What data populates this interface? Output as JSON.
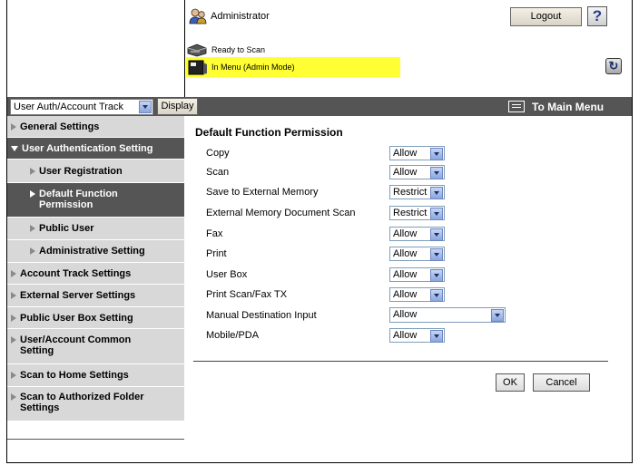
{
  "header": {
    "admin_label": "Administrator",
    "logout_label": "Logout",
    "help_label": "?",
    "status_ready": "Ready to Scan",
    "status_menu": "In Menu (Admin Mode)"
  },
  "toolbar": {
    "mode_select_value": "User Auth/Account Track",
    "display_label": "Display",
    "main_menu_label": "To Main Menu"
  },
  "sidebar": {
    "items": [
      {
        "label": "General Settings"
      },
      {
        "label": "User Authentication Setting"
      },
      {
        "label": "User Registration"
      },
      {
        "label": "Default Function Permission"
      },
      {
        "label": "Public User"
      },
      {
        "label": "Administrative Setting"
      },
      {
        "label": "Account Track Settings"
      },
      {
        "label": "External Server Settings"
      },
      {
        "label": "Public User Box Setting"
      },
      {
        "label": "User/Account Common Setting"
      },
      {
        "label": "Scan to Home Settings"
      },
      {
        "label": "Scan to Authorized Folder Settings"
      }
    ]
  },
  "content": {
    "title": "Default Function Permission",
    "rows": [
      {
        "label": "Copy",
        "value": "Allow"
      },
      {
        "label": "Scan",
        "value": "Allow"
      },
      {
        "label": "Save to External Memory",
        "value": "Restrict"
      },
      {
        "label": "External Memory Document Scan",
        "value": "Restrict"
      },
      {
        "label": "Fax",
        "value": "Allow"
      },
      {
        "label": "Print",
        "value": "Allow"
      },
      {
        "label": "User Box",
        "value": "Allow"
      },
      {
        "label": "Print Scan/Fax TX",
        "value": "Allow"
      },
      {
        "label": "Manual Destination Input",
        "value": "Allow"
      },
      {
        "label": "Mobile/PDA",
        "value": "Allow"
      }
    ],
    "ok_label": "OK",
    "cancel_label": "Cancel"
  }
}
